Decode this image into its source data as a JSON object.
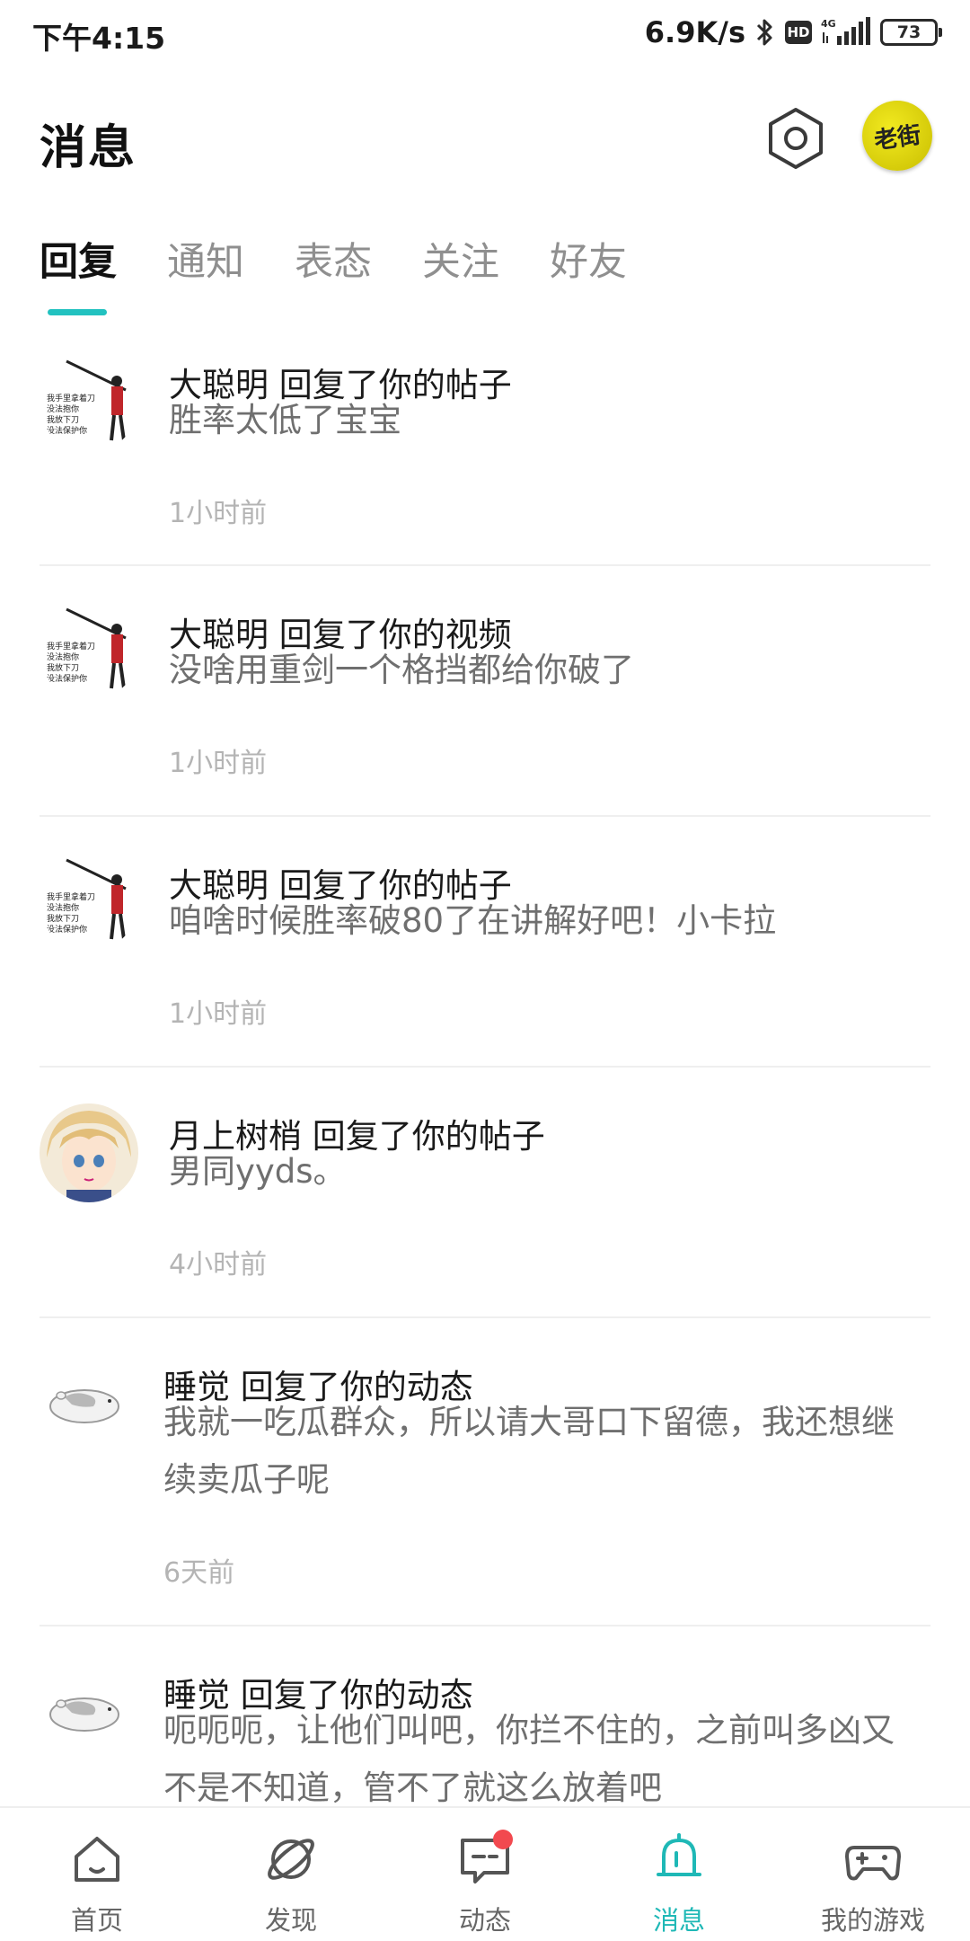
{
  "status_bar": {
    "time": "下午4:15",
    "net_speed": "6.9K/s",
    "hd": "HD",
    "network": "4G",
    "battery": "73"
  },
  "header": {
    "title": "消息",
    "avatar_text": "老街"
  },
  "tabs": [
    {
      "label": "回复",
      "active": true
    },
    {
      "label": "通知",
      "active": false
    },
    {
      "label": "表态",
      "active": false
    },
    {
      "label": "关注",
      "active": false
    },
    {
      "label": "好友",
      "active": false
    }
  ],
  "avatar_image_lines": [
    "我手里拿着刀",
    "没法抱你",
    "我放下刀",
    "没法保护你"
  ],
  "messages": [
    {
      "title": "大聪明 回复了你的帖子",
      "body": "胜率太低了宝宝",
      "time": "1小时前",
      "avatar": "swordsman"
    },
    {
      "title": "大聪明 回复了你的视频",
      "body": "没啥用重剑一个格挡都给你破了",
      "time": "1小时前",
      "avatar": "swordsman"
    },
    {
      "title": "大聪明 回复了你的帖子",
      "body": "咱啥时候胜率破80了在讲解好吧！小卡拉",
      "time": "1小时前",
      "avatar": "swordsman"
    },
    {
      "title": "月上树梢 回复了你的帖子",
      "body": "男同yyds。",
      "time": "4小时前",
      "avatar": "anime"
    },
    {
      "title": "睡觉 回复了你的动态",
      "body": "我就一吃瓜群众，所以请大哥口下留德，我还想继续卖瓜子呢",
      "time": "6天前",
      "avatar": "hamster"
    },
    {
      "title": "睡觉 回复了你的动态",
      "body": "呃呃呃，让他们叫吧，你拦不住的，之前叫多凶又不是不知道，管不了就这么放着吧",
      "time": "",
      "avatar": "hamster"
    }
  ],
  "bottom_nav": [
    {
      "label": "首页",
      "icon": "home-icon",
      "active": false
    },
    {
      "label": "发现",
      "icon": "planet-icon",
      "active": false
    },
    {
      "label": "动态",
      "icon": "chat-icon",
      "active": false,
      "badge": true
    },
    {
      "label": "消息",
      "icon": "bell-icon",
      "active": true
    },
    {
      "label": "我的游戏",
      "icon": "gamepad-icon",
      "active": false
    }
  ],
  "colors": {
    "accent": "#22c2c0",
    "badge": "#f2494f"
  }
}
